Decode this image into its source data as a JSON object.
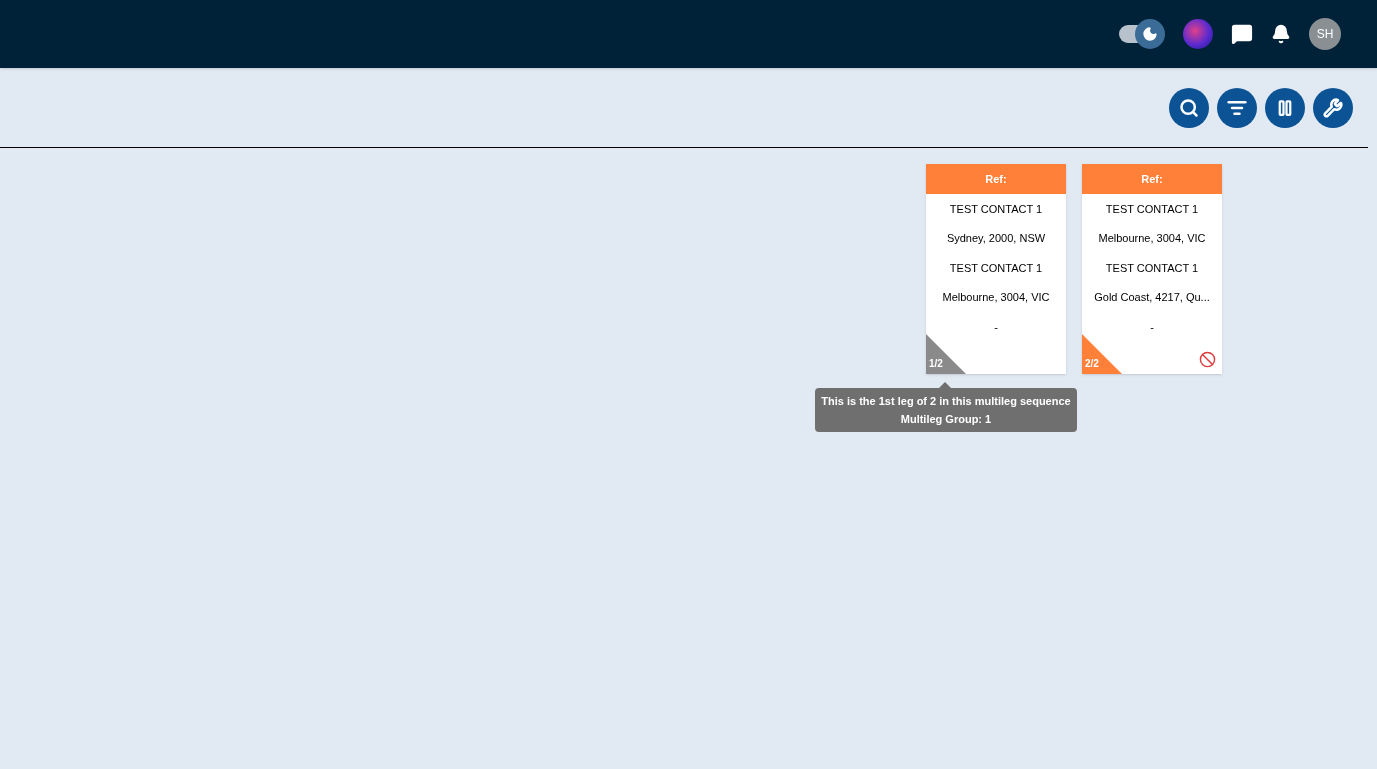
{
  "header": {
    "theme_toggle": {
      "on": true
    },
    "avatar_initials": "SH"
  },
  "toolbar": [
    {
      "kind": "search"
    },
    {
      "kind": "filter"
    },
    {
      "kind": "pause"
    },
    {
      "kind": "tools"
    }
  ],
  "cards": [
    {
      "title": "Ref:",
      "lines": [
        "TEST CONTACT 1",
        "Sydney, 2000, NSW",
        "TEST CONTACT 1",
        "Melbourne, 3004, VIC",
        "-"
      ],
      "leg": "1/2",
      "color": "#8a8a8a",
      "blocked": false,
      "tooltip": [
        "This is the 1st leg of 2 in this multileg sequence",
        "Multileg Group: 1"
      ]
    },
    {
      "title": "Ref:",
      "lines": [
        "TEST CONTACT 1",
        "Melbourne, 3004, VIC",
        "TEST CONTACT 1",
        "Gold Coast, 4217, Qu...",
        "-"
      ],
      "leg": "2/2",
      "color": "#ff8038",
      "blocked": true
    }
  ]
}
